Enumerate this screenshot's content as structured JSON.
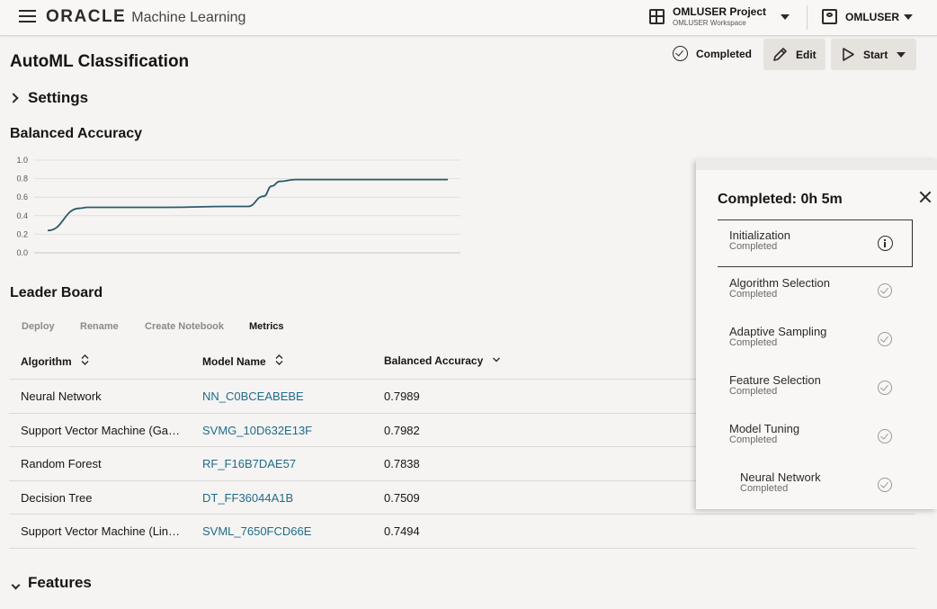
{
  "app": {
    "brand_oracle": "ORACLE",
    "brand_product": "Machine Learning",
    "project_name": "OMLUSER Project",
    "workspace_name": "OMLUSER Workspace",
    "user_name": "OMLUSER"
  },
  "header": {
    "title": "AutoML Classification",
    "status": "Completed",
    "edit_label": "Edit",
    "start_label": "Start"
  },
  "sections": {
    "settings": "Settings",
    "balanced_accuracy": "Balanced Accuracy",
    "leader_board": "Leader Board",
    "features": "Features"
  },
  "chart_data": {
    "type": "line",
    "title": "",
    "xlabel": "",
    "ylabel": "",
    "ylim": [
      0.0,
      1.0
    ],
    "y_ticks": [
      "1.0",
      "0.8",
      "0.6",
      "0.4",
      "0.2",
      "0.0"
    ],
    "grid": true,
    "series": [
      {
        "color": "#2e5a6a",
        "points": [
          [
            0,
            0.24
          ],
          [
            0.08,
            0.48
          ],
          [
            0.1,
            0.49
          ],
          [
            0.3,
            0.49
          ],
          [
            0.45,
            0.5
          ],
          [
            0.5,
            0.5
          ],
          [
            0.54,
            0.61
          ],
          [
            0.56,
            0.72
          ],
          [
            0.58,
            0.77
          ],
          [
            0.62,
            0.79
          ],
          [
            1.0,
            0.79
          ]
        ]
      }
    ]
  },
  "toolbar": {
    "items": [
      "Deploy",
      "Rename",
      "Create Notebook",
      "Metrics"
    ],
    "active": "Metrics"
  },
  "table": {
    "headers": [
      "Algorithm",
      "Model Name",
      "Balanced Accuracy"
    ],
    "rows": [
      [
        "Neural Network",
        "NN_C0BCEABEBE",
        "0.7989"
      ],
      [
        "Support Vector Machine (Ga…",
        "SVMG_10D632E13F",
        "0.7982"
      ],
      [
        "Random Forest",
        "RF_F16B7DAE57",
        "0.7838"
      ],
      [
        "Decision Tree",
        "DT_FF36044A1B",
        "0.7509"
      ],
      [
        "Support Vector Machine (Lin…",
        "SVML_7650FCD66E",
        "0.7494"
      ]
    ]
  },
  "panel": {
    "title": "Completed: 0h 5m",
    "steps": [
      {
        "name": "Initialization",
        "status": "Completed",
        "icon": "info-icon"
      },
      {
        "name": "Algorithm Selection",
        "status": "Completed",
        "icon": "check-circle-icon"
      },
      {
        "name": "Adaptive Sampling",
        "status": "Completed",
        "icon": "check-circle-icon"
      },
      {
        "name": "Feature Selection",
        "status": "Completed",
        "icon": "check-circle-icon"
      },
      {
        "name": "Model Tuning",
        "status": "Completed",
        "icon": "check-circle-icon"
      },
      {
        "name": "Neural Network",
        "status": "Completed",
        "icon": "check-circle-icon"
      }
    ]
  }
}
